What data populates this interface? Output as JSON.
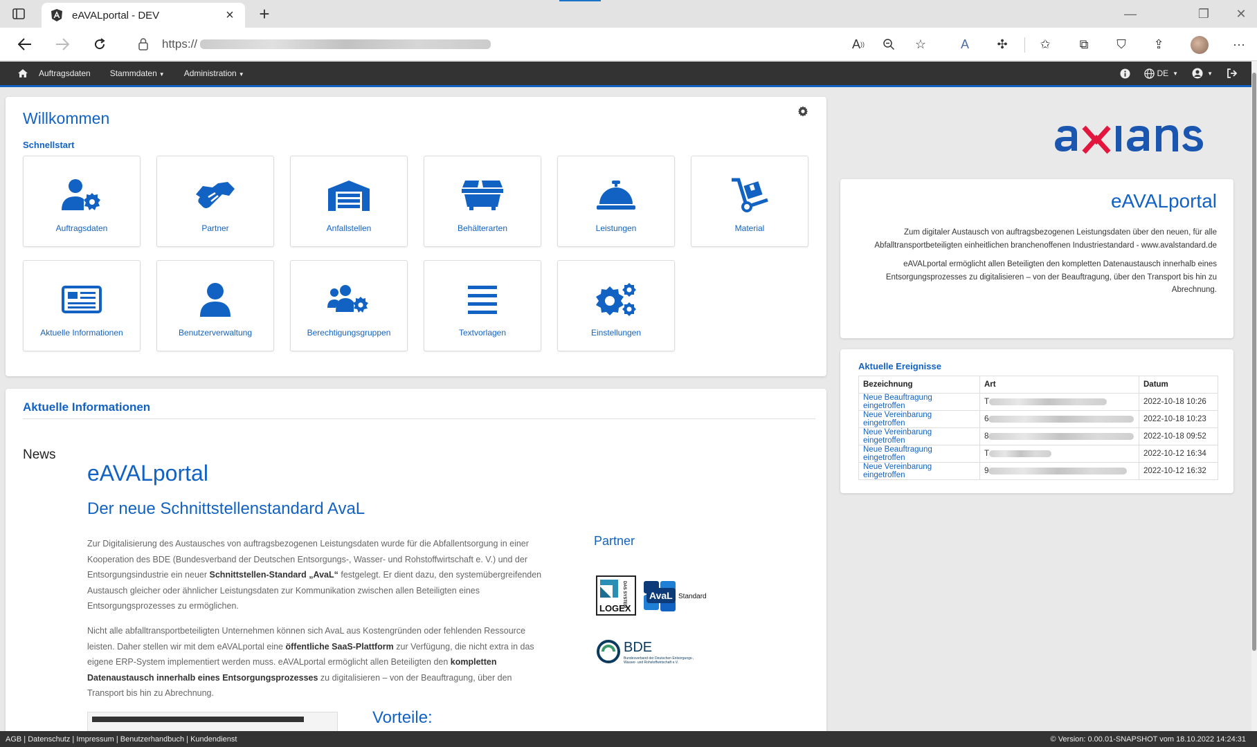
{
  "browser": {
    "tab_title": "eAVALportal - DEV",
    "url_prefix": "https://"
  },
  "navbar": {
    "items": [
      "Auftragsdaten",
      "Stammdaten",
      "Administration"
    ],
    "language": "DE"
  },
  "welcome": {
    "title": "Willkommen",
    "quickstart_label": "Schnellstart",
    "tiles": [
      {
        "label": "Auftragsdaten",
        "icon": "user-gear-icon"
      },
      {
        "label": "Partner",
        "icon": "handshake-icon"
      },
      {
        "label": "Anfallstellen",
        "icon": "warehouse-icon"
      },
      {
        "label": "Behälterarten",
        "icon": "dumpster-icon"
      },
      {
        "label": "Leistungen",
        "icon": "bell-concierge-icon"
      },
      {
        "label": "Material",
        "icon": "dolly-icon"
      },
      {
        "label": "Aktuelle Informationen",
        "icon": "newspaper-icon"
      },
      {
        "label": "Benutzerverwaltung",
        "icon": "user-icon"
      },
      {
        "label": "Berechtigungsgruppen",
        "icon": "users-gear-icon"
      },
      {
        "label": "Textvorlagen",
        "icon": "list-icon"
      },
      {
        "label": "Einstellungen",
        "icon": "gears-icon"
      }
    ]
  },
  "info": {
    "title": "Aktuelle Informationen",
    "news_label": "News",
    "h1": "eAVALportal",
    "h2": "Der neue Schnittstellenstandard AvaL",
    "p1_a": "Zur Digitalisierung des Austausches von auftragsbezogenen Leistungsdaten wurde für die Abfallentsorgung in einer Kooperation des BDE (Bundesverband der Deutschen Entsorgungs-, Wasser- und Rohstoffwirtschaft e. V.) und der Entsorgungsindustrie ein neuer ",
    "p1_b": "Schnittstellen-Standard „AvaL“",
    "p1_c": " festgelegt. Er dient dazu, den systemübergreifenden Austausch gleicher oder ähnlicher Leistungsdaten zur Kommunikation zwischen allen Beteiligten eines Entsorgungsprozesses zu ermöglichen.",
    "p2_a": "Nicht alle abfalltransportbeteiligten Unternehmen können sich AvaL aus Kostengründen oder fehlenden Ressource leisten. Daher stellen wir mit dem eAVALportal eine ",
    "p2_b": "öffentliche SaaS-Plattform",
    "p2_c": " zur Verfügung, die nicht extra in das eigene ERP-System implementiert werden muss. eAVALportal ermöglicht allen Beteiligten den ",
    "p2_d": "kompletten Datenaustausch innerhalb eines Entsorgungsprozesses",
    "p2_e": " zu digitalisieren – von der Beauftragung, über den Transport bis hin zu Abrechnung.",
    "partner_label": "Partner",
    "vorteile": "Vorteile:",
    "logos": {
      "logex": "LOGEX",
      "logex_side": "DAS SYSTEM",
      "aval": "AvaL",
      "aval_side": "Standard",
      "bde": "BDE",
      "bde_sub1": "Bundesverband der Deutschen Entsorgungs-,",
      "bde_sub2": "Wasser- und Rohstoffwirtschaft e.V."
    }
  },
  "portal": {
    "title": "eAVALportal",
    "p1": "Zum digitaler Austausch von auftragsbezogenen Leistungsdaten über den neuen, für alle Abfalltransportbeteiligten einheitlichen branchenoffenen Industriestandard - www.avalstandard.de",
    "p2": "eAVALportal ermöglicht allen Beteiligten den kompletten Datenaustausch innerhalb eines Entsorgungsprozesses zu digitalisieren – von der Beauftragung, über den Transport bis hin zu Abrechnung."
  },
  "events": {
    "title": "Aktuelle Ereignisse",
    "headers": [
      "Bezeichnung",
      "Art",
      "Datum"
    ],
    "rows": [
      {
        "bezeichnung": "Neue Beauftragung eingetroffen",
        "art_initial": "T",
        "datum": "2022-10-18 10:26"
      },
      {
        "bezeichnung": "Neue Vereinbarung eingetroffen",
        "art_initial": "6",
        "datum": "2022-10-18 10:23"
      },
      {
        "bezeichnung": "Neue Vereinbarung eingetroffen",
        "art_initial": "8",
        "datum": "2022-10-18 09:52"
      },
      {
        "bezeichnung": "Neue Beauftragung eingetroffen",
        "art_initial": "T",
        "datum": "2022-10-12 16:34"
      },
      {
        "bezeichnung": "Neue Vereinbarung eingetroffen",
        "art_initial": "9",
        "datum": "2022-10-12 16:32"
      }
    ]
  },
  "footer": {
    "links": [
      "AGB",
      "Datenschutz",
      "Impressum",
      "Benutzerhandbuch",
      "Kundendienst"
    ],
    "version": "© Version: 0.00.01-SNAPSHOT vom 18.10.2022 14:24:31"
  },
  "colors": {
    "brand_blue": "#1262c4",
    "navbar_bg": "#333333",
    "axians_blue": "#1a56b0",
    "axians_red": "#e3173e"
  }
}
